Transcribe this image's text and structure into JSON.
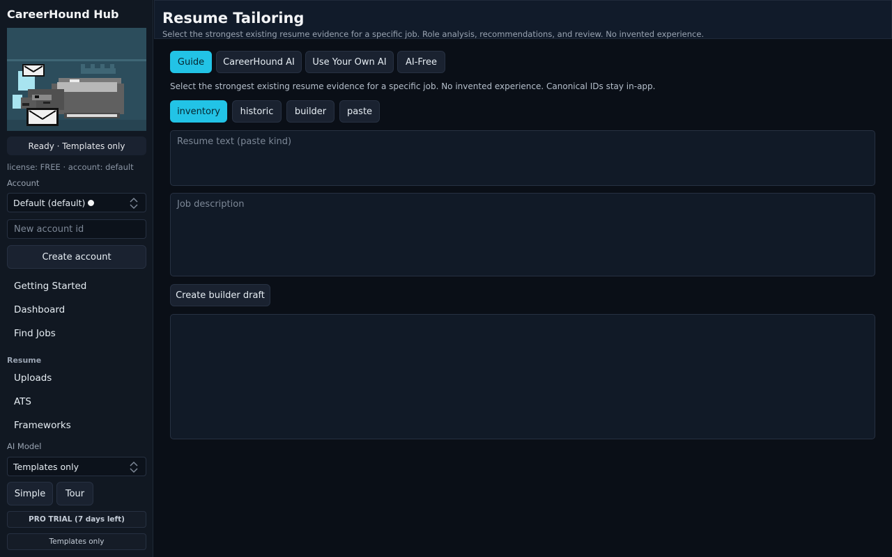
{
  "sidebar": {
    "app_title": "CareerHound Hub",
    "status": "Ready · Templates only",
    "license_line": "license: FREE · account: default",
    "account_label": "Account",
    "account_selected": "Default (default)",
    "new_account_placeholder": "New account id",
    "create_account_label": "Create account",
    "nav": [
      {
        "label": "Getting Started"
      },
      {
        "label": "Dashboard"
      },
      {
        "label": "Find Jobs"
      }
    ],
    "resume_section_label": "Resume",
    "resume_nav": [
      {
        "label": "Uploads"
      },
      {
        "label": "ATS"
      },
      {
        "label": "Frameworks"
      }
    ],
    "ai_model_label": "AI Model",
    "ai_model_selected": "Templates only",
    "simple_label": "Simple",
    "tour_label": "Tour",
    "trial_badge": "PRO TRIAL (7 days left)",
    "mode_badge": "Templates only"
  },
  "header": {
    "title": "Resume Tailoring",
    "subtitle": "Select the strongest existing resume evidence for a specific job. Role analysis, recommendations, and review. No invented experience."
  },
  "mode_tabs": [
    {
      "label": "Guide",
      "active": true
    },
    {
      "label": "CareerHound AI",
      "active": false
    },
    {
      "label": "Use Your Own AI",
      "active": false
    },
    {
      "label": "AI-Free",
      "active": false
    }
  ],
  "helper_text": "Select the strongest existing resume evidence for a specific job. No invented experience. Canonical IDs stay in-app.",
  "source_tabs": [
    {
      "label": "inventory",
      "active": true
    },
    {
      "label": "historic",
      "active": false
    },
    {
      "label": "builder",
      "active": false
    },
    {
      "label": "paste",
      "active": false
    }
  ],
  "resume_text_placeholder": "Resume text (paste kind)",
  "job_description_placeholder": "Job description",
  "create_draft_label": "Create builder draft",
  "colors": {
    "accent": "#22c3e6",
    "background": "#0a0f17",
    "sidebar": "#111822",
    "panel": "#111a27",
    "border": "#273142",
    "mascot_bg": "#2c4d5c"
  },
  "icons": [
    "select-arrows-icon",
    "status-dot-icon",
    "envelope-icon",
    "mascot-image"
  ]
}
